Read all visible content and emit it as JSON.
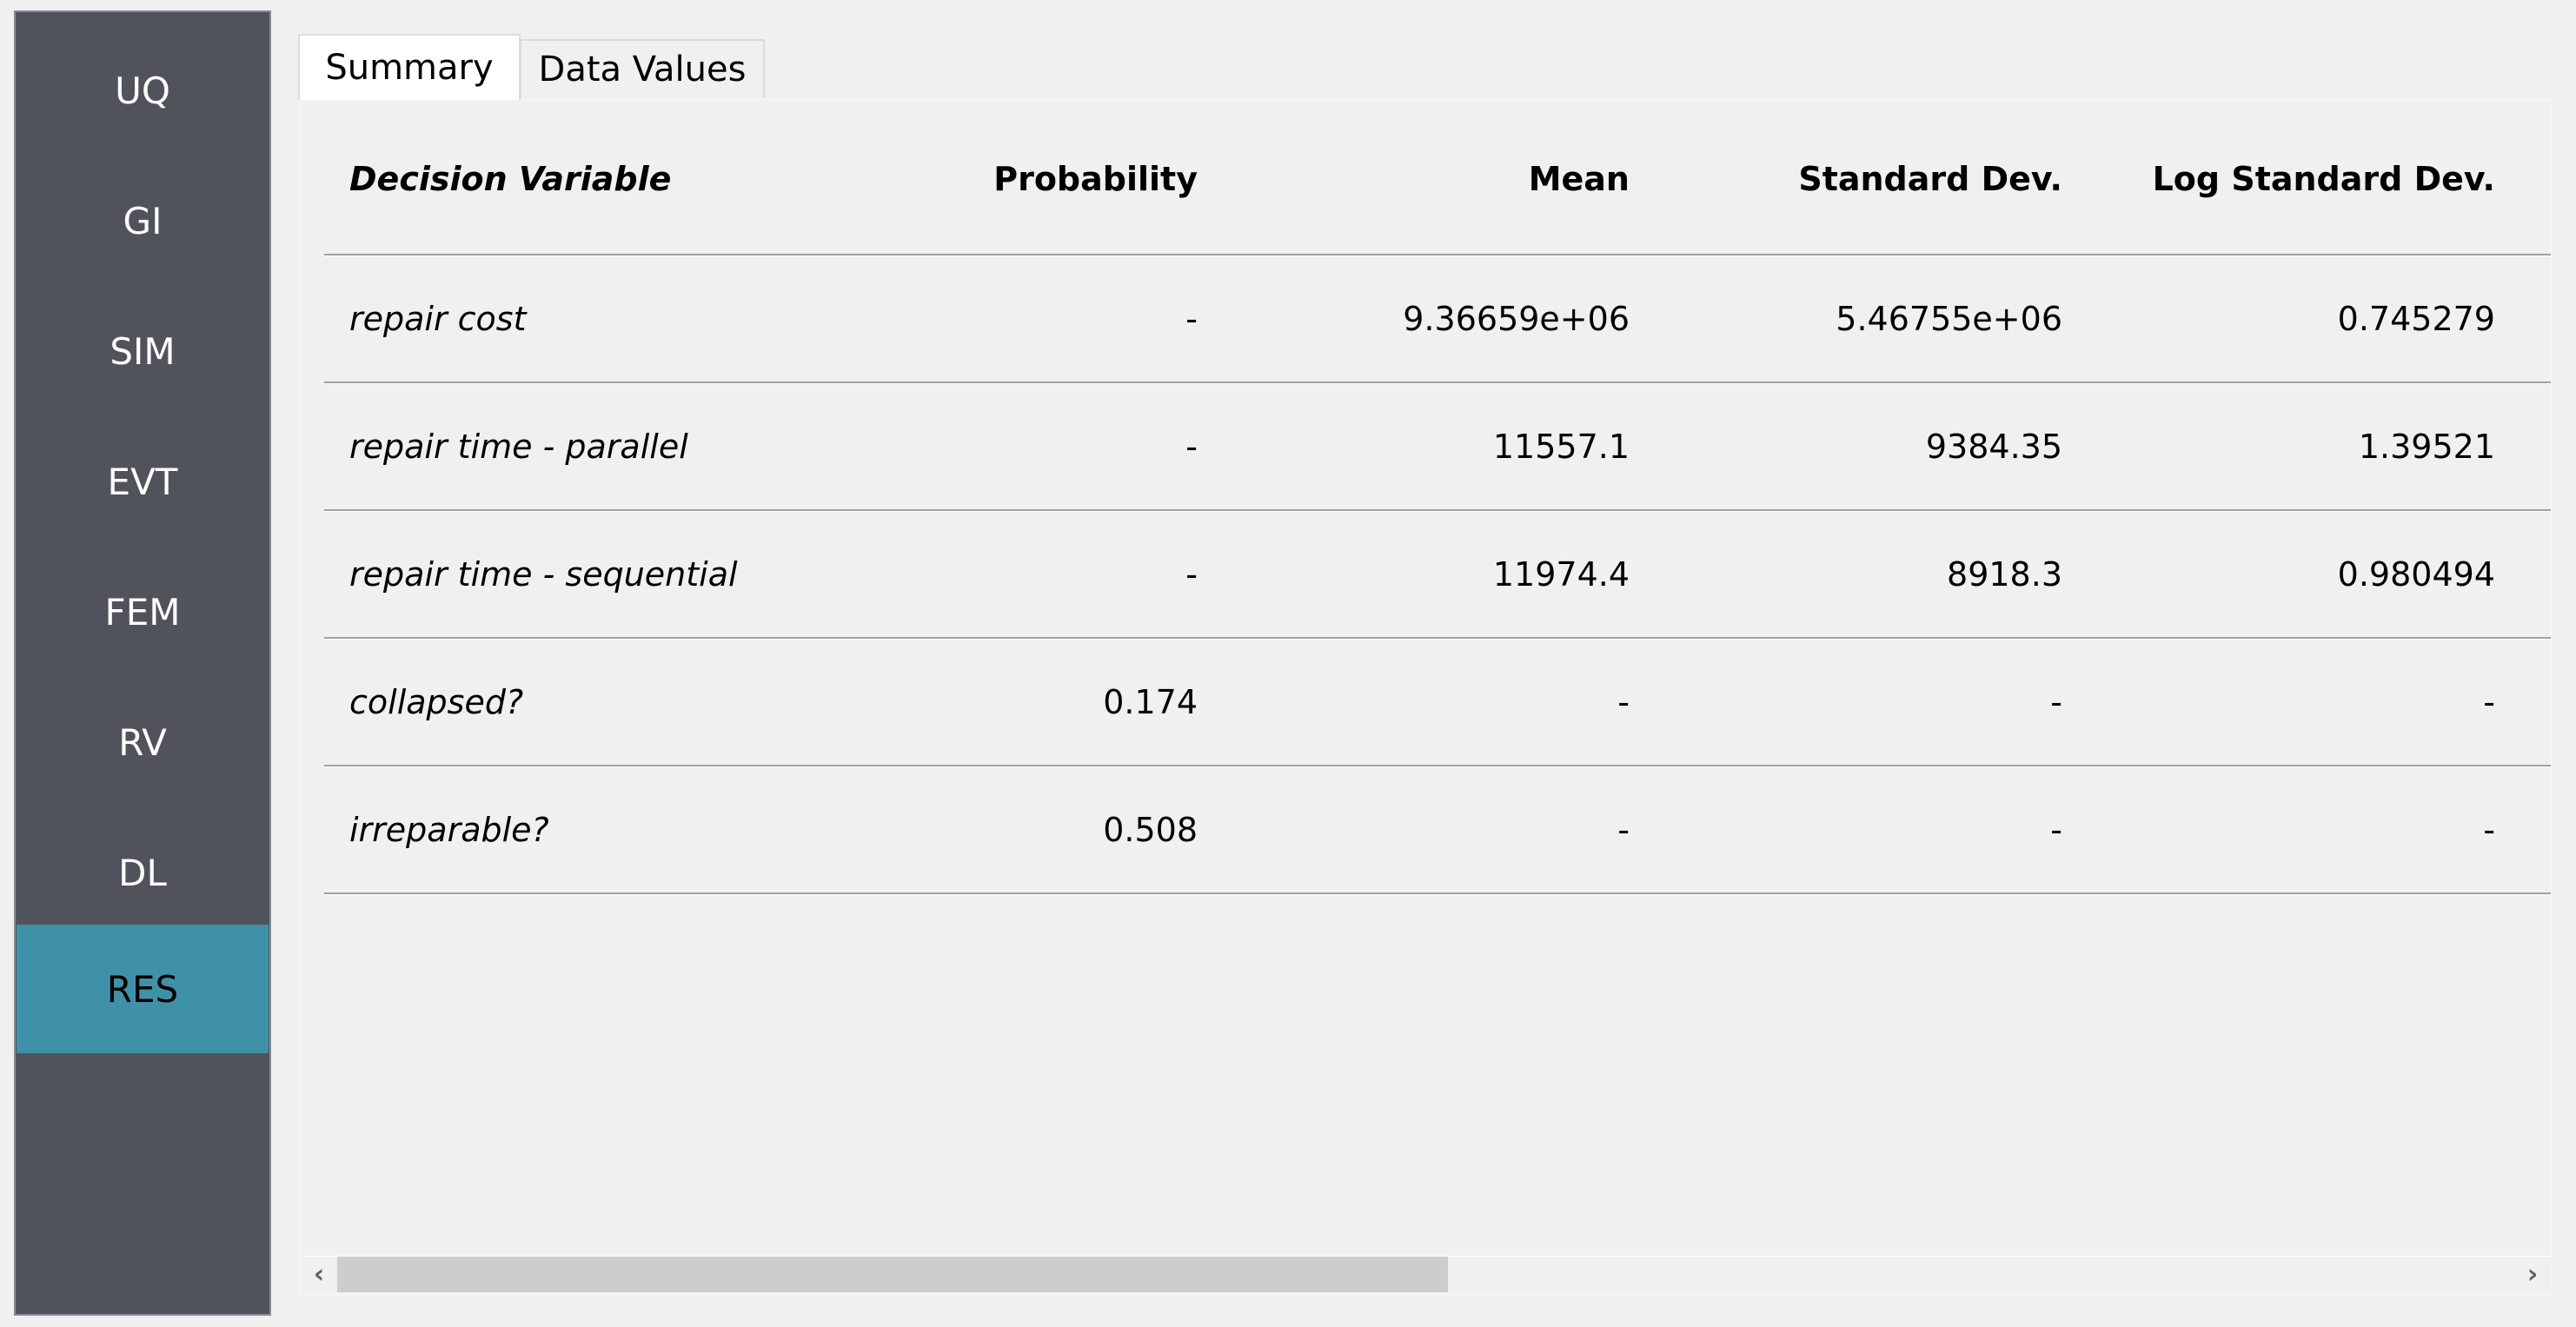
{
  "sidebar": {
    "items": [
      {
        "label": "UQ",
        "active": false
      },
      {
        "label": "GI",
        "active": false
      },
      {
        "label": "SIM",
        "active": false
      },
      {
        "label": "EVT",
        "active": false
      },
      {
        "label": "FEM",
        "active": false
      },
      {
        "label": "RV",
        "active": false
      },
      {
        "label": "DL",
        "active": false
      },
      {
        "label": "RES",
        "active": true
      }
    ],
    "active_color": "#3f91a7",
    "background_color": "#50535b"
  },
  "tabs": [
    {
      "label": "Summary",
      "selected": true
    },
    {
      "label": "Data Values",
      "selected": false
    }
  ],
  "table": {
    "headers": [
      "Decision Variable",
      "Probability",
      "Mean",
      "Standard Dev.",
      "Log Standard Dev."
    ],
    "rows": [
      [
        "repair cost",
        "-",
        "9.36659e+06",
        "5.46755e+06",
        "0.745279"
      ],
      [
        "repair time - parallel",
        "-",
        "11557.1",
        "9384.35",
        "1.39521"
      ],
      [
        "repair time - sequential",
        "-",
        "11974.4",
        "8918.3",
        "0.980494"
      ],
      [
        "collapsed?",
        "0.174",
        "-",
        "-",
        "-"
      ],
      [
        "irreparable?",
        "0.508",
        "-",
        "-",
        "-"
      ]
    ]
  },
  "scrollbar": {
    "left_icon": "chevron-left-icon",
    "right_icon": "chevron-right-icon",
    "left_glyph": "‹",
    "right_glyph": "›",
    "position_fraction": 0.0,
    "visible_fraction": 0.5
  }
}
